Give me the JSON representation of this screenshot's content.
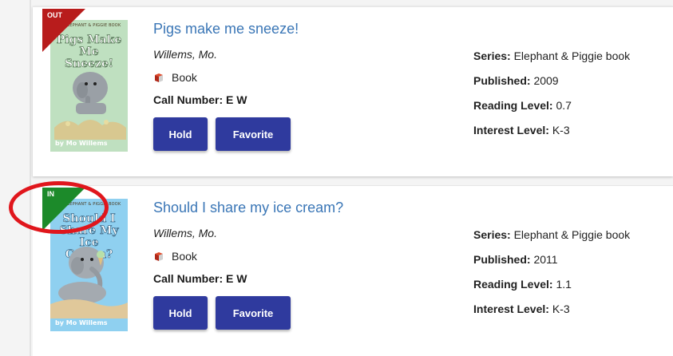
{
  "results": [
    {
      "availability": "OUT",
      "availability_color": "#b81c1c",
      "cover": {
        "band_text": "AN ELEPHANT & PIGGIE BOOK",
        "title_text": "Pigs Make Me Sneeze!",
        "author_text": "by Mo Willems",
        "background": "#bfe0c0"
      },
      "title": "Pigs make me sneeze!",
      "author": "Willems, Mo.",
      "format_icon": "book-icon",
      "format": "Book",
      "call_number": "Call Number: E W",
      "hold_label": "Hold",
      "favorite_label": "Favorite",
      "series_label": "Series:",
      "series": "Elephant & Piggie book",
      "published_label": "Published:",
      "published": "2009",
      "reading_level_label": "Reading Level:",
      "reading_level": "0.7",
      "interest_level_label": "Interest Level:",
      "interest_level": "K-3"
    },
    {
      "availability": "IN",
      "availability_color": "#1c8a2a",
      "cover": {
        "band_text": "AN ELEPHANT & PIGGIE BOOK",
        "title_text": "Should I Share My Ice Cream?",
        "author_text": "by Mo Willems",
        "background": "#8fd0f0"
      },
      "title": "Should I share my ice cream?",
      "author": "Willems, Mo.",
      "format_icon": "book-icon",
      "format": "Book",
      "call_number": "Call Number: E W",
      "hold_label": "Hold",
      "favorite_label": "Favorite",
      "series_label": "Series:",
      "series": "Elephant & Piggie book",
      "published_label": "Published:",
      "published": "2011",
      "reading_level_label": "Reading Level:",
      "reading_level": "1.1",
      "interest_level_label": "Interest Level:",
      "interest_level": "K-3"
    }
  ],
  "colors": {
    "title_link": "#3a76b6",
    "button_bg": "#2f3a9e",
    "callout": "#e0161c"
  },
  "annotation": {
    "type": "red-circle-highlight",
    "target": "IN availability badge"
  }
}
